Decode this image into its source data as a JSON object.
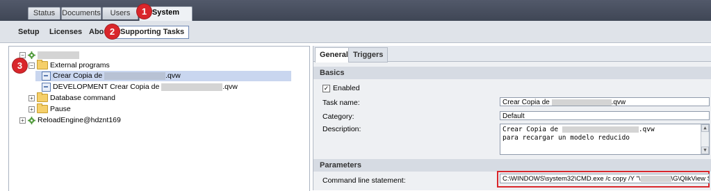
{
  "top_tabs": [
    "Status",
    "Documents",
    "Users",
    "System"
  ],
  "sub_tabs": [
    "Setup",
    "Licenses",
    "About",
    "Supporting Tasks"
  ],
  "markers": [
    "1",
    "2",
    "3"
  ],
  "tree": {
    "external_programs": "External programs",
    "item1_prefix": "Crear Copia de",
    "item1_suffix": ".qvw",
    "item2_prefix": "DEVELOPMENT Crear Copia de",
    "item2_suffix": ".qvw",
    "database_command": "Database command",
    "pause": "Pause",
    "reload_engine": "ReloadEngine@hdznt169"
  },
  "right_tabs": [
    "General",
    "Triggers"
  ],
  "basics": {
    "section_title": "Basics",
    "enabled_label": "Enabled",
    "enabled_check": "✓",
    "task_name_label": "Task name:",
    "task_name_prefix": "Crear Copia de",
    "task_name_suffix": ".qvw",
    "category_label": "Category:",
    "category_value": "Default",
    "description_label": "Description:",
    "description_prefix": "Crear Copia de",
    "description_suffix": ".qvw",
    "description_line2": "para recargar un modelo reducido"
  },
  "parameters": {
    "section_title": "Parameters",
    "command_label": "Command line statement:",
    "command_prefix": "C:\\WINDOWS\\system32\\CMD.exe /c copy /Y \"\\",
    "command_suffix": "\\G\\QlikView Stora"
  },
  "colors": {
    "marker": "#d9262b",
    "selected_row": "#c9d6ef",
    "topbar": "#4a5161"
  }
}
